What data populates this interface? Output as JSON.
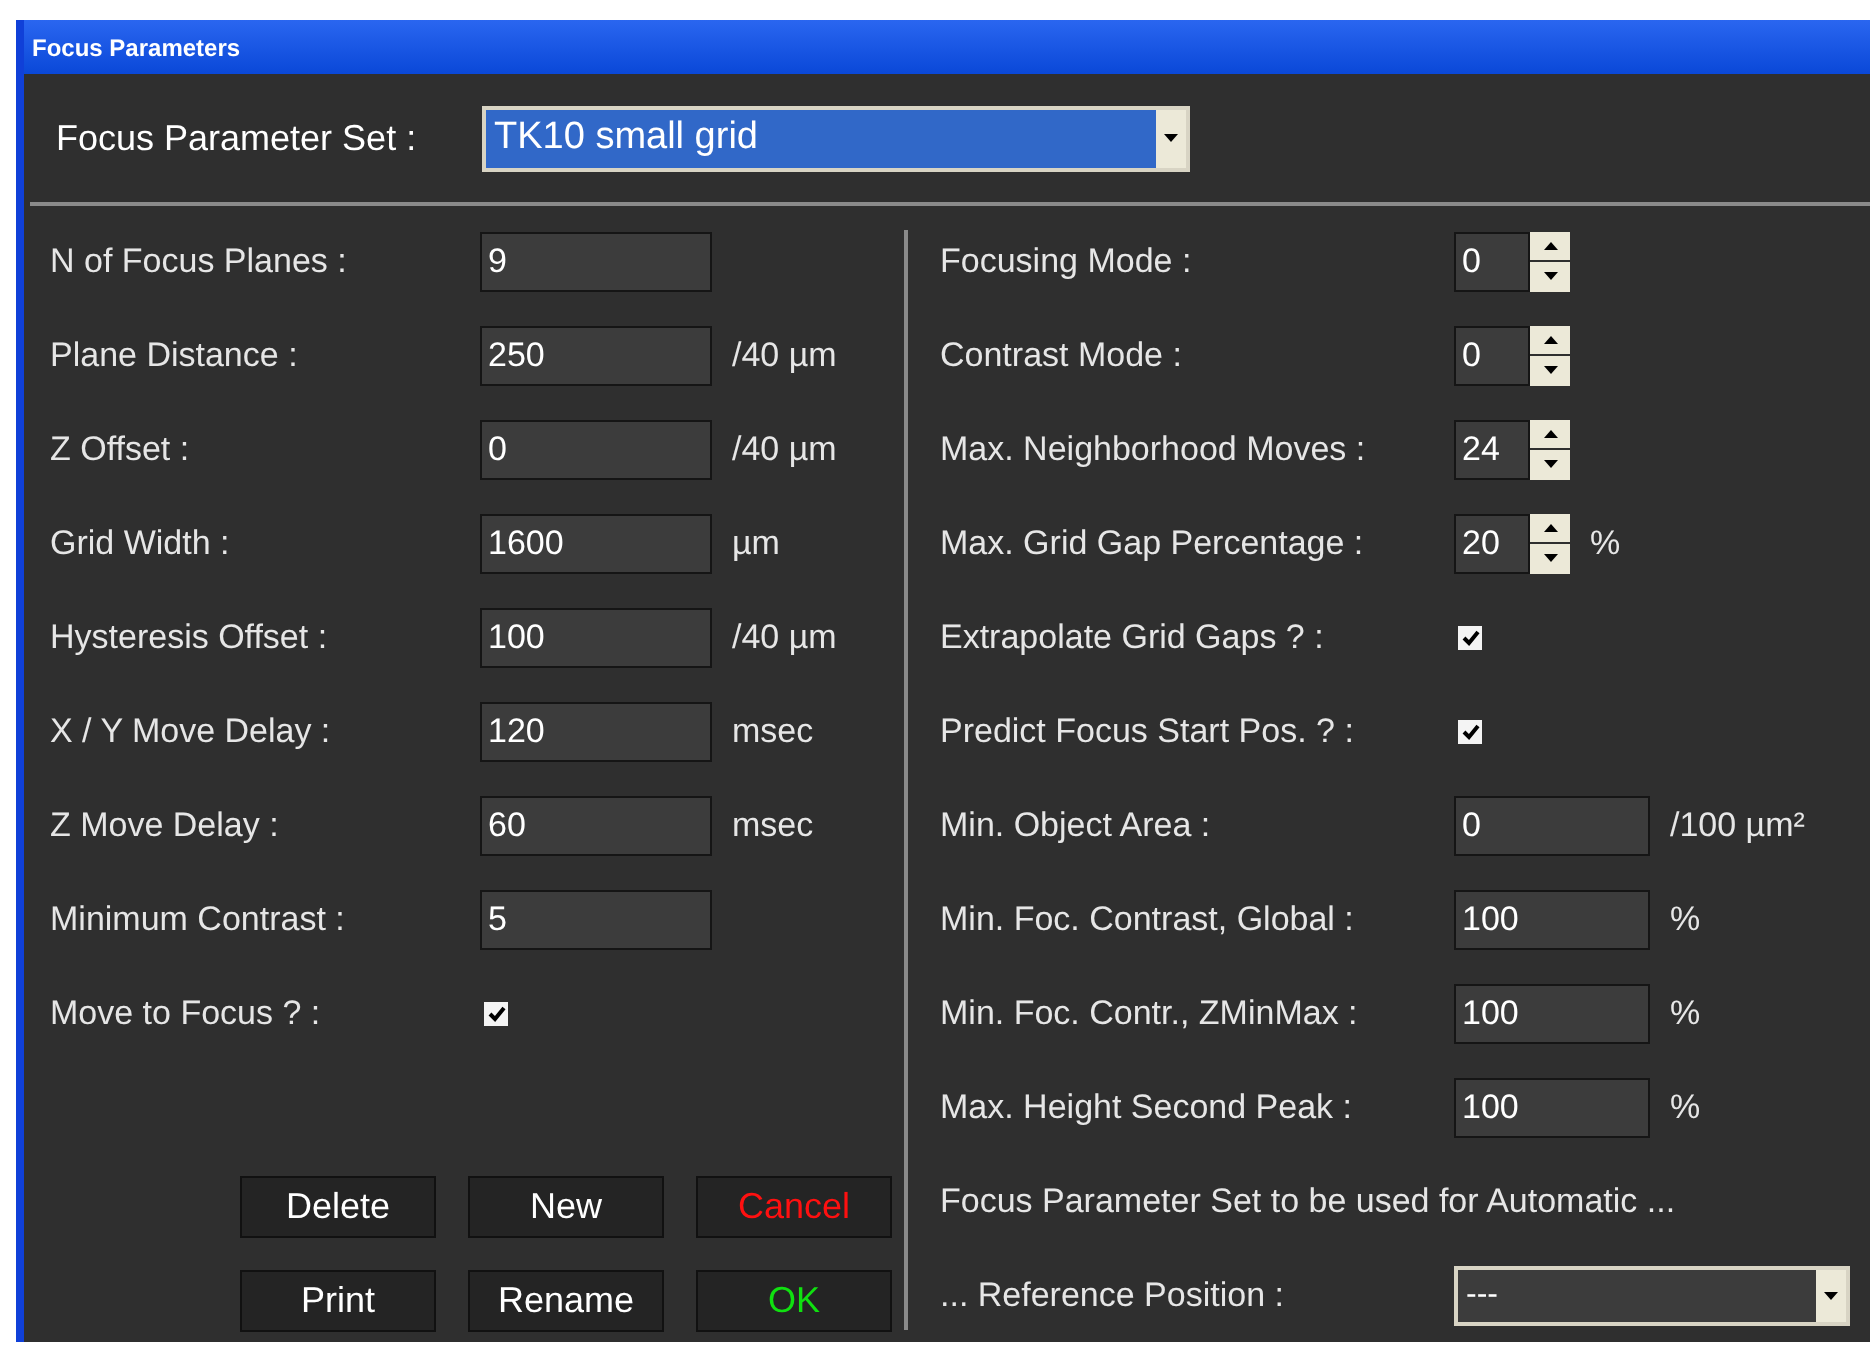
{
  "window": {
    "title": "Focus Parameters"
  },
  "parameter_set": {
    "label": "Focus Parameter Set :",
    "value": "TK10 small grid"
  },
  "left_rows": [
    {
      "kind": "field",
      "label": "N of Focus Planes :",
      "value": "9"
    },
    {
      "kind": "field",
      "label": "Plane Distance :",
      "value": "250",
      "unit": "/40 µm"
    },
    {
      "kind": "field",
      "label": "Z Offset :",
      "value": "0",
      "unit": "/40 µm"
    },
    {
      "kind": "field",
      "label": "Grid Width :",
      "value": "1600",
      "unit": "µm"
    },
    {
      "kind": "field",
      "label": "Hysteresis Offset :",
      "value": "100",
      "unit": "/40 µm"
    },
    {
      "kind": "field",
      "label": "X / Y Move Delay :",
      "value": "120",
      "unit": "msec"
    },
    {
      "kind": "field",
      "label": "Z Move Delay :",
      "value": "60",
      "unit": "msec"
    },
    {
      "kind": "field",
      "label": "Minimum Contrast :",
      "value": "5"
    },
    {
      "kind": "checkbox",
      "label": "Move to Focus ? :",
      "checked": true
    }
  ],
  "buttons": [
    {
      "label": "Delete",
      "color": "#ffffff"
    },
    {
      "label": "New",
      "color": "#ffffff"
    },
    {
      "label": "Cancel",
      "color": "#ff1010"
    },
    {
      "label": "Print",
      "color": "#ffffff"
    },
    {
      "label": "Rename",
      "color": "#ffffff"
    },
    {
      "label": "OK",
      "color": "#10e010"
    }
  ],
  "right_rows": [
    {
      "kind": "spinner",
      "label": "Focusing Mode :",
      "value": "0"
    },
    {
      "kind": "spinner",
      "label": "Contrast Mode :",
      "value": "0"
    },
    {
      "kind": "spinner",
      "label": "Max. Neighborhood Moves :",
      "value": "24"
    },
    {
      "kind": "spinner",
      "label": "Max. Grid Gap Percentage :",
      "value": "20",
      "unit": "%"
    },
    {
      "kind": "checkbox",
      "label": "Extrapolate Grid Gaps ? :",
      "checked": true
    },
    {
      "kind": "checkbox",
      "label": "Predict Focus Start Pos. ? :",
      "checked": true
    },
    {
      "kind": "field",
      "label": "Min. Object Area :",
      "value": "0",
      "unit": "/100 µm²"
    },
    {
      "kind": "field",
      "label": "Min. Foc. Contrast, Global :",
      "value": "100",
      "unit": "%"
    },
    {
      "kind": "field",
      "label": "Min. Foc. Contr., ZMinMax :",
      "value": "100",
      "unit": "%"
    },
    {
      "kind": "field",
      "label": "Max. Height Second Peak :",
      "value": "100",
      "unit": "%"
    },
    {
      "kind": "note",
      "text": "Focus Parameter Set to be used for Automatic ..."
    },
    {
      "kind": "dropdown",
      "label": "... Reference Position :",
      "value": "---"
    }
  ]
}
